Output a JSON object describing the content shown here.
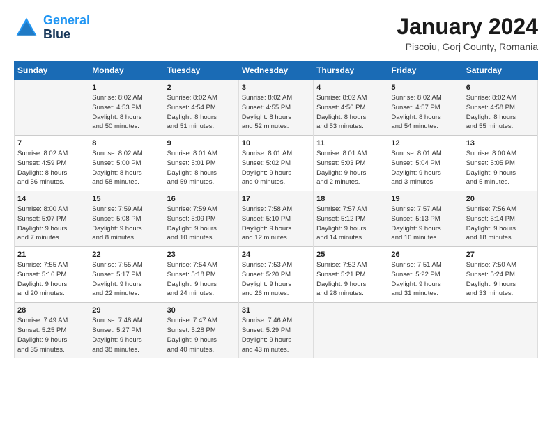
{
  "logo": {
    "line1": "General",
    "line2": "Blue"
  },
  "title": "January 2024",
  "subtitle": "Piscoiu, Gorj County, Romania",
  "days_of_week": [
    "Sunday",
    "Monday",
    "Tuesday",
    "Wednesday",
    "Thursday",
    "Friday",
    "Saturday"
  ],
  "weeks": [
    [
      {
        "num": "",
        "info": ""
      },
      {
        "num": "1",
        "info": "Sunrise: 8:02 AM\nSunset: 4:53 PM\nDaylight: 8 hours\nand 50 minutes."
      },
      {
        "num": "2",
        "info": "Sunrise: 8:02 AM\nSunset: 4:54 PM\nDaylight: 8 hours\nand 51 minutes."
      },
      {
        "num": "3",
        "info": "Sunrise: 8:02 AM\nSunset: 4:55 PM\nDaylight: 8 hours\nand 52 minutes."
      },
      {
        "num": "4",
        "info": "Sunrise: 8:02 AM\nSunset: 4:56 PM\nDaylight: 8 hours\nand 53 minutes."
      },
      {
        "num": "5",
        "info": "Sunrise: 8:02 AM\nSunset: 4:57 PM\nDaylight: 8 hours\nand 54 minutes."
      },
      {
        "num": "6",
        "info": "Sunrise: 8:02 AM\nSunset: 4:58 PM\nDaylight: 8 hours\nand 55 minutes."
      }
    ],
    [
      {
        "num": "7",
        "info": "Sunrise: 8:02 AM\nSunset: 4:59 PM\nDaylight: 8 hours\nand 56 minutes."
      },
      {
        "num": "8",
        "info": "Sunrise: 8:02 AM\nSunset: 5:00 PM\nDaylight: 8 hours\nand 58 minutes."
      },
      {
        "num": "9",
        "info": "Sunrise: 8:01 AM\nSunset: 5:01 PM\nDaylight: 8 hours\nand 59 minutes."
      },
      {
        "num": "10",
        "info": "Sunrise: 8:01 AM\nSunset: 5:02 PM\nDaylight: 9 hours\nand 0 minutes."
      },
      {
        "num": "11",
        "info": "Sunrise: 8:01 AM\nSunset: 5:03 PM\nDaylight: 9 hours\nand 2 minutes."
      },
      {
        "num": "12",
        "info": "Sunrise: 8:01 AM\nSunset: 5:04 PM\nDaylight: 9 hours\nand 3 minutes."
      },
      {
        "num": "13",
        "info": "Sunrise: 8:00 AM\nSunset: 5:05 PM\nDaylight: 9 hours\nand 5 minutes."
      }
    ],
    [
      {
        "num": "14",
        "info": "Sunrise: 8:00 AM\nSunset: 5:07 PM\nDaylight: 9 hours\nand 7 minutes."
      },
      {
        "num": "15",
        "info": "Sunrise: 7:59 AM\nSunset: 5:08 PM\nDaylight: 9 hours\nand 8 minutes."
      },
      {
        "num": "16",
        "info": "Sunrise: 7:59 AM\nSunset: 5:09 PM\nDaylight: 9 hours\nand 10 minutes."
      },
      {
        "num": "17",
        "info": "Sunrise: 7:58 AM\nSunset: 5:10 PM\nDaylight: 9 hours\nand 12 minutes."
      },
      {
        "num": "18",
        "info": "Sunrise: 7:57 AM\nSunset: 5:12 PM\nDaylight: 9 hours\nand 14 minutes."
      },
      {
        "num": "19",
        "info": "Sunrise: 7:57 AM\nSunset: 5:13 PM\nDaylight: 9 hours\nand 16 minutes."
      },
      {
        "num": "20",
        "info": "Sunrise: 7:56 AM\nSunset: 5:14 PM\nDaylight: 9 hours\nand 18 minutes."
      }
    ],
    [
      {
        "num": "21",
        "info": "Sunrise: 7:55 AM\nSunset: 5:16 PM\nDaylight: 9 hours\nand 20 minutes."
      },
      {
        "num": "22",
        "info": "Sunrise: 7:55 AM\nSunset: 5:17 PM\nDaylight: 9 hours\nand 22 minutes."
      },
      {
        "num": "23",
        "info": "Sunrise: 7:54 AM\nSunset: 5:18 PM\nDaylight: 9 hours\nand 24 minutes."
      },
      {
        "num": "24",
        "info": "Sunrise: 7:53 AM\nSunset: 5:20 PM\nDaylight: 9 hours\nand 26 minutes."
      },
      {
        "num": "25",
        "info": "Sunrise: 7:52 AM\nSunset: 5:21 PM\nDaylight: 9 hours\nand 28 minutes."
      },
      {
        "num": "26",
        "info": "Sunrise: 7:51 AM\nSunset: 5:22 PM\nDaylight: 9 hours\nand 31 minutes."
      },
      {
        "num": "27",
        "info": "Sunrise: 7:50 AM\nSunset: 5:24 PM\nDaylight: 9 hours\nand 33 minutes."
      }
    ],
    [
      {
        "num": "28",
        "info": "Sunrise: 7:49 AM\nSunset: 5:25 PM\nDaylight: 9 hours\nand 35 minutes."
      },
      {
        "num": "29",
        "info": "Sunrise: 7:48 AM\nSunset: 5:27 PM\nDaylight: 9 hours\nand 38 minutes."
      },
      {
        "num": "30",
        "info": "Sunrise: 7:47 AM\nSunset: 5:28 PM\nDaylight: 9 hours\nand 40 minutes."
      },
      {
        "num": "31",
        "info": "Sunrise: 7:46 AM\nSunset: 5:29 PM\nDaylight: 9 hours\nand 43 minutes."
      },
      {
        "num": "",
        "info": ""
      },
      {
        "num": "",
        "info": ""
      },
      {
        "num": "",
        "info": ""
      }
    ]
  ]
}
